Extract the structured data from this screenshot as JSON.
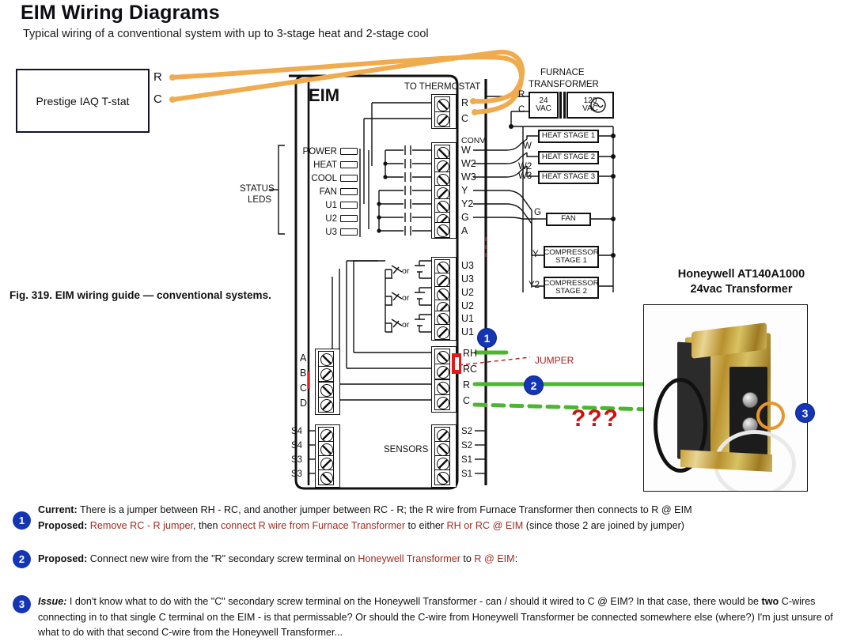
{
  "header": {
    "title": "EIM Wiring Diagrams",
    "subtitle": "Typical wiring of a conventional system with up to 3-stage heat and 2-stage cool"
  },
  "figure": {
    "caption": "Fig. 319. EIM wiring guide — conventional systems.",
    "eim_label": "EIM",
    "to_thermostat_label": "TO THERMOSTAT",
    "conv_label": "CONV",
    "sensors_label": "SENSORS",
    "status_leds_line1": "STATUS",
    "status_leds_line2": "LEDS"
  },
  "thermostat": {
    "box_label": "Prestige IAQ T-stat",
    "terminal_r": "R",
    "terminal_c": "C"
  },
  "status_leds": [
    {
      "label": "POWER"
    },
    {
      "label": "HEAT"
    },
    {
      "label": "COOL"
    },
    {
      "label": "FAN"
    },
    {
      "label": "U1"
    },
    {
      "label": "U2"
    },
    {
      "label": "U3"
    }
  ],
  "terminals": {
    "thermostat_block": [
      "R",
      "C"
    ],
    "conv_block": [
      "W",
      "W2",
      "W3",
      "Y",
      "Y2",
      "G",
      "A"
    ],
    "universal_block": [
      "U3",
      "U3",
      "U2",
      "U2",
      "U1",
      "U1"
    ],
    "power_block": [
      "RH",
      "RC",
      "R",
      "C"
    ],
    "abcd_block": [
      "A",
      "B",
      "C",
      "D"
    ],
    "s4s3_block": [
      "S4",
      "S4",
      "S3",
      "S3"
    ],
    "s2s1_block": [
      "S2",
      "S2",
      "S1",
      "S1"
    ],
    "or_label": "or"
  },
  "furnace_transformer": {
    "title_line1": "FURNACE",
    "title_line2": "TRANSFORMER",
    "terminal_r": "R",
    "terminal_c": "C",
    "secondary": "24\nVAC",
    "secondary_v": "24",
    "secondary_unit": "VAC",
    "primary_v": "120",
    "primary_unit": "VAC"
  },
  "equipment": [
    {
      "terminal": "W",
      "label": "HEAT STAGE 1"
    },
    {
      "terminal": "W2",
      "label": "HEAT STAGE 2"
    },
    {
      "terminal": "W3",
      "label": "HEAT STAGE 3"
    },
    {
      "terminal": "G",
      "label": "FAN"
    },
    {
      "terminal": "Y",
      "label": "COMPRESSOR STAGE 1",
      "line1": "COMPRESSOR",
      "line2": "STAGE 1"
    },
    {
      "terminal": "Y2",
      "label": "COMPRESSOR STAGE 2",
      "line1": "COMPRESSOR",
      "line2": "STAGE 2"
    }
  ],
  "honeywell": {
    "title_line1": "Honeywell  AT140A1000",
    "title_line2": "24vac Transformer"
  },
  "annotations": {
    "jumper_label": "JUMPER",
    "question_marks": "???",
    "marker1": "1",
    "marker2": "2",
    "marker3": "3"
  },
  "notes": [
    {
      "number": "1",
      "lines": [
        {
          "label": "Current:",
          "segments": [
            {
              "text": " There is a jumper between RH - RC, and another jumper between RC - R; the R wire from Furnace Transformer then connects to R @ EIM",
              "color": "black"
            }
          ]
        },
        {
          "label": "Proposed:",
          "segments": [
            {
              "text": "  ",
              "color": "black"
            },
            {
              "text": "Remove RC - R jumper",
              "color": "red"
            },
            {
              "text": ", then ",
              "color": "black"
            },
            {
              "text": "connect R wire from Furnace Transformer",
              "color": "red"
            },
            {
              "text": " to either ",
              "color": "black"
            },
            {
              "text": "RH or RC @ EIM",
              "color": "red"
            },
            {
              "text": " (since those 2 are joined by jumper)",
              "color": "black"
            }
          ]
        }
      ]
    },
    {
      "number": "2",
      "lines": [
        {
          "label": "Proposed:",
          "segments": [
            {
              "text": "  Connect new wire from the \"R\" secondary screw terminal on ",
              "color": "black"
            },
            {
              "text": "Honeywell Transformer",
              "color": "red"
            },
            {
              "text": " to ",
              "color": "black"
            },
            {
              "text": "R @ EIM",
              "color": "red"
            },
            {
              "text": ":",
              "color": "black"
            }
          ]
        }
      ]
    },
    {
      "number": "3",
      "lines": [
        {
          "label": "Issue:",
          "italic": true,
          "segments": [
            {
              "text": "  I don't know what to do with the \"C\" secondary screw terminal on the Honeywell Transformer - can / should it wired to C @ EIM?  In that case, there would be ",
              "color": "black"
            },
            {
              "text": "two",
              "color": "black",
              "bold": true
            },
            {
              "text": " C-wires connecting in to that single C terminal on the EIM - is that permissable?  Or should the C-wire from Honeywell Transformer be connected somewhere else (where?)   I'm just unsure of what to do with that second C-wire from the Honeywell Transformer...",
              "color": "black"
            }
          ]
        }
      ]
    }
  ],
  "colors": {
    "wire_orange": "#f0ab4e",
    "wire_green": "#4cb531",
    "marker_blue": "#1436b4",
    "jumper_red": "#e01b1b",
    "accent_red": "#9e2b20",
    "highlight_orange": "#e8962c"
  }
}
